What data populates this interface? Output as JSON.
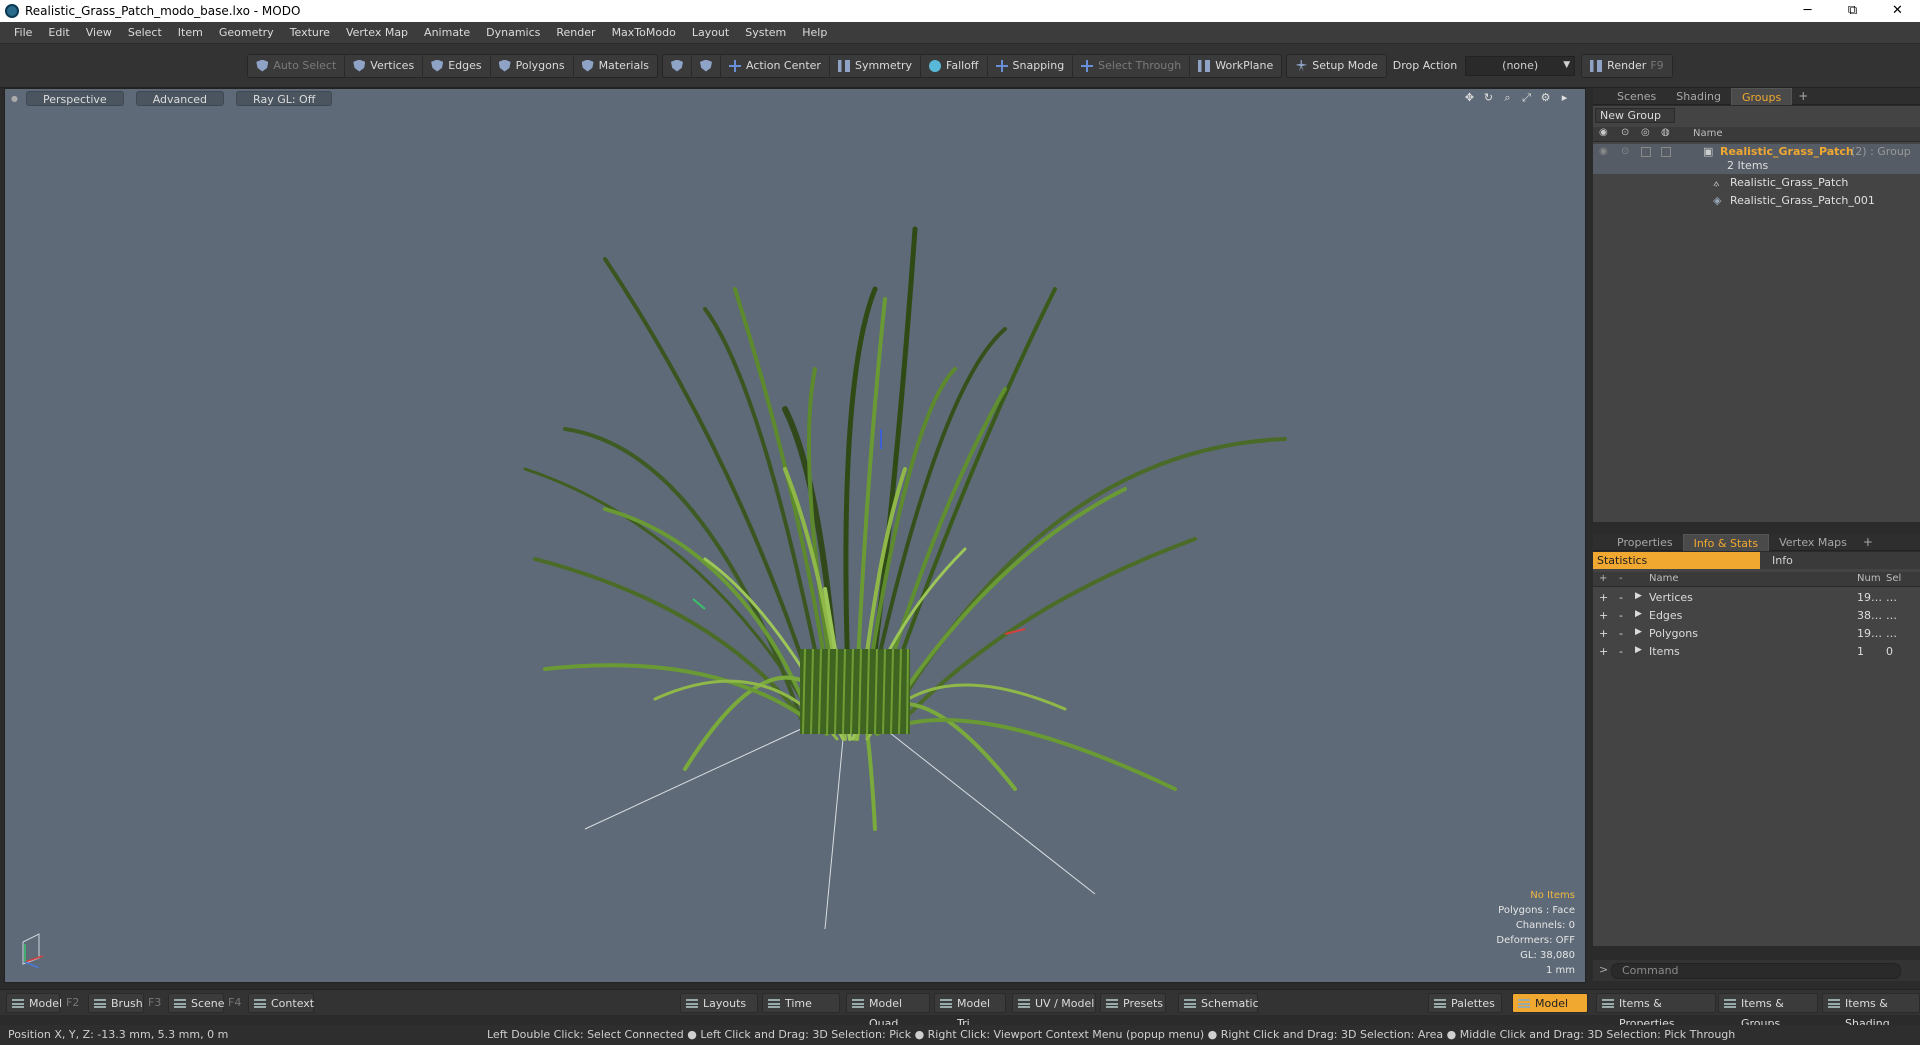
{
  "window": {
    "title": "Realistic_Grass_Patch_modo_base.lxo - MODO",
    "minimize": "─",
    "maximize": "⧉",
    "close": "✕"
  },
  "menu": [
    "File",
    "Edit",
    "View",
    "Select",
    "Item",
    "Geometry",
    "Texture",
    "Vertex Map",
    "Animate",
    "Dynamics",
    "Render",
    "MaxToModo",
    "Layout",
    "System",
    "Help"
  ],
  "toolbar": {
    "auto_select": "Auto Select",
    "vertices": "Vertices",
    "edges": "Edges",
    "polygons": "Polygons",
    "materials": "Materials",
    "action_center": "Action Center",
    "symmetry": "Symmetry",
    "falloff": "Falloff",
    "snapping": "Snapping",
    "select_through": "Select Through",
    "workplane": "WorkPlane",
    "setup_mode": "Setup Mode",
    "drop_action_label": "Drop Action",
    "drop_action_value": "(none)",
    "render": "Render",
    "render_key": "F9"
  },
  "viewport": {
    "tabs": [
      "Perspective",
      "Advanced",
      "Ray GL: Off"
    ],
    "info": {
      "selection": "No Items",
      "polygons": "Polygons : Face",
      "channels": "Channels: 0",
      "deformers": "Deformers: OFF",
      "gl": "GL: 38,080",
      "scale": "1 mm"
    }
  },
  "groups_panel": {
    "tabs": [
      "Scenes",
      "Shading",
      "Groups"
    ],
    "active_tab": "Groups",
    "new_group": "New Group",
    "column_name": "Name",
    "group": {
      "name": "Realistic_Grass_Patch",
      "suffix": "(2) : Group",
      "count_label": "2 Items",
      "children": [
        "Realistic_Grass_Patch",
        "Realistic_Grass_Patch_001"
      ]
    }
  },
  "stats_panel": {
    "tabs": [
      "Properties",
      "Info & Stats",
      "Vertex Maps"
    ],
    "active_tab": "Info & Stats",
    "subtabs": {
      "statistics": "Statistics",
      "info": "Info"
    },
    "columns": {
      "name": "Name",
      "num": "Num",
      "sel": "Sel"
    },
    "rows": [
      {
        "name": "Vertices",
        "num": "19…",
        "sel": "…"
      },
      {
        "name": "Edges",
        "num": "38…",
        "sel": "…"
      },
      {
        "name": "Polygons",
        "num": "19…",
        "sel": "…"
      },
      {
        "name": "Items",
        "num": "1",
        "sel": "0"
      }
    ]
  },
  "command": {
    "placeholder": "Command"
  },
  "bottom": {
    "model": "Model",
    "f2": "F2",
    "brush": "Brush",
    "f3": "F3",
    "scene": "Scene",
    "f4": "F4",
    "context": "Context",
    "layouts": "Layouts",
    "time": "Time",
    "model_quad": "Model Quad",
    "model_tri": "Model Tri",
    "uv_model": "UV / Model",
    "presets": "Presets",
    "schematic": "Schematic",
    "palettes": "Palettes",
    "model_active": "Model",
    "items_properties": "Items & Properties",
    "items_groups": "Items & Groups",
    "items_shading": "Items & Shading"
  },
  "status": {
    "position": "Position X, Y, Z:   -13.3 mm, 5.3 mm, 0 m",
    "hints": "Left Double Click: Select Connected ● Left Click and Drag: 3D Selection: Pick ● Right Click: Viewport Context Menu (popup menu) ● Right Click and Drag: 3D Selection: Area ● Middle Click and Drag: 3D Selection: Pick Through"
  },
  "colors": {
    "accent": "#f0a830",
    "viewport_bg": "#5e6a77",
    "grass_dark": "#2f4a14",
    "grass_light": "#8fb848"
  }
}
